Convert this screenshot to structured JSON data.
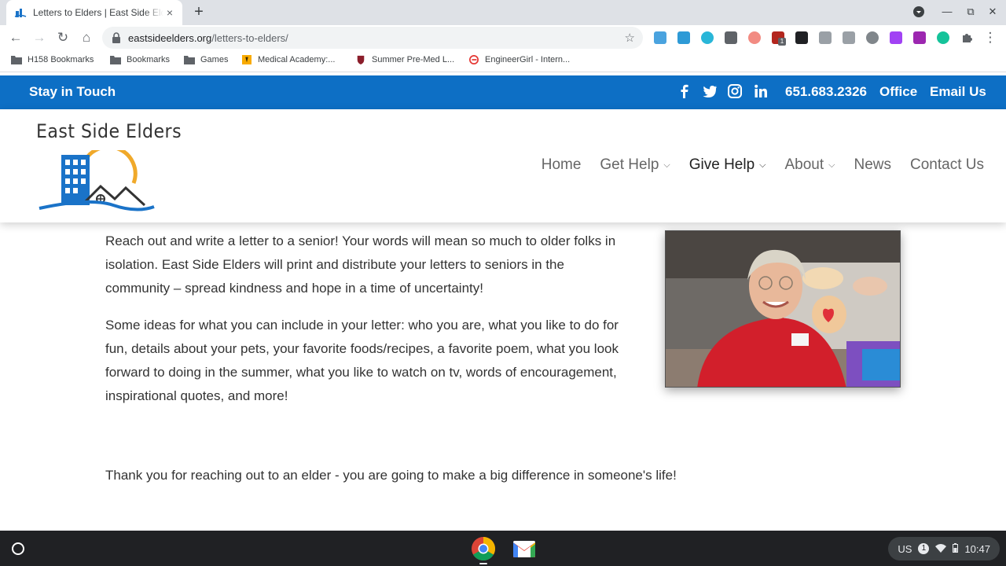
{
  "browser": {
    "tab": {
      "title": "Letters to Elders | East Side Elders",
      "close": "×"
    },
    "new_tab": "+",
    "window": {
      "account": "▾",
      "minimize": "—",
      "restore": "⧉",
      "close": "✕"
    },
    "nav": {
      "back": "←",
      "forward": "→",
      "reload": "↻",
      "home": "⌂"
    },
    "omnibox": {
      "domain": "eastsideelders.org",
      "path": "/letters-to-elders/",
      "star": "☆"
    },
    "bookmarks": [
      {
        "label": "H158 Bookmarks",
        "icon": "bookmarks-folder-icon"
      },
      {
        "label": "Bookmarks",
        "icon": "folder-icon"
      },
      {
        "label": "Games",
        "icon": "folder-icon"
      },
      {
        "label": "Medical Academy:...",
        "icon": "medical-academy-icon"
      },
      {
        "label": "Summer Pre-Med L...",
        "icon": "shield-crest-icon"
      },
      {
        "label": "EngineerGirl - Intern...",
        "icon": "engineergirl-icon"
      }
    ],
    "extension_badge": "1"
  },
  "topbar": {
    "stay_in_touch": "Stay in Touch",
    "social": [
      "facebook-icon",
      "twitter-icon",
      "instagram-icon",
      "linkedin-icon"
    ],
    "phone": "651.683.2326",
    "office": "Office",
    "email": "Email Us",
    "color": "#0d6fc5"
  },
  "logo": {
    "text": "East Side Elders"
  },
  "nav": {
    "items": [
      {
        "label": "Home",
        "dropdown": false,
        "active": false
      },
      {
        "label": "Get Help",
        "dropdown": true,
        "active": false
      },
      {
        "label": "Give Help",
        "dropdown": true,
        "active": true
      },
      {
        "label": "About",
        "dropdown": true,
        "active": false
      },
      {
        "label": "News",
        "dropdown": false,
        "active": false
      },
      {
        "label": "Contact Us",
        "dropdown": false,
        "active": false
      }
    ],
    "chevron": "⌄"
  },
  "content": {
    "intro": "Reach out and write a letter to a senior!  Your words will mean so much to older folks in isolation.  East Side Elders will print and distribute your letters to seniors in the community – spread kindness and hope in a time of uncertainty!",
    "ideas": "Some ideas for what you can include in your letter:  who you are, what you like to do for fun, details about your pets, your favorite foods/recipes, a favorite poem, what you look forward to doing in the summer, what you like to watch on tv, words of encouragement, inspirational quotes, and more!",
    "thanks": "Thank you for reaching out to an elder - you are going to make a big difference in someone's life!"
  },
  "shelf": {
    "apps": [
      "chrome-icon",
      "gmail-icon"
    ],
    "tray": {
      "locale": "US",
      "notifications": "1",
      "time": "10:47"
    }
  }
}
